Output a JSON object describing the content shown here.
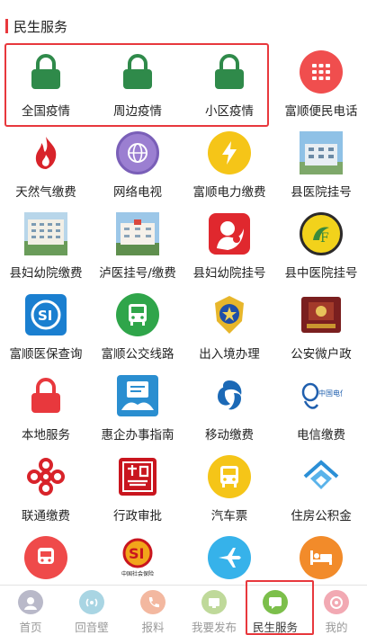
{
  "section": {
    "title": "民生服务"
  },
  "services": [
    {
      "label": "全国疫情",
      "icon": "green-lock-icon"
    },
    {
      "label": "周边疫情",
      "icon": "green-lock-icon"
    },
    {
      "label": "小区疫情",
      "icon": "green-lock-icon"
    },
    {
      "label": "富顺便民电话",
      "icon": "phone-keypad-icon"
    },
    {
      "label": "天然气缴费",
      "icon": "gas-flame-icon"
    },
    {
      "label": "网络电视",
      "icon": "network-tv-icon"
    },
    {
      "label": "富顺电力缴费",
      "icon": "lightning-icon"
    },
    {
      "label": "县医院挂号",
      "icon": "hospital-building-photo"
    },
    {
      "label": "县妇幼院缴费",
      "icon": "hospital-photo"
    },
    {
      "label": "泸医挂号/缴费",
      "icon": "hospital-photo"
    },
    {
      "label": "县妇幼院挂号",
      "icon": "maternal-child-logo"
    },
    {
      "label": "县中医院挂号",
      "icon": "tcm-hospital-logo"
    },
    {
      "label": "富顺医保查询",
      "icon": "social-insurance-icon"
    },
    {
      "label": "富顺公交线路",
      "icon": "bus-icon"
    },
    {
      "label": "出入境办理",
      "icon": "police-badge-icon"
    },
    {
      "label": "公安微户政",
      "icon": "household-register-icon"
    },
    {
      "label": "本地服务",
      "icon": "red-lock-icon"
    },
    {
      "label": "惠企办事指南",
      "icon": "enterprise-guide-icon"
    },
    {
      "label": "移动缴费",
      "icon": "china-mobile-icon"
    },
    {
      "label": "电信缴费",
      "icon": "china-telecom-icon"
    },
    {
      "label": "联通缴费",
      "icon": "china-unicom-icon"
    },
    {
      "label": "行政审批",
      "icon": "administrative-seal-icon"
    },
    {
      "label": "汽车票",
      "icon": "coach-bus-icon"
    },
    {
      "label": "住房公积金",
      "icon": "housing-fund-icon"
    },
    {
      "label": "",
      "icon": "metro-icon"
    },
    {
      "label": "",
      "icon": "social-security-logo"
    },
    {
      "label": "",
      "icon": "airplane-icon"
    },
    {
      "label": "",
      "icon": "hotel-bed-icon"
    }
  ],
  "social_logo_text": "中国社会保险",
  "telecom_logo_text": "中国电信",
  "tabs": [
    {
      "label": "首页",
      "icon": "home-avatar-icon"
    },
    {
      "label": "回音壁",
      "icon": "echo-wall-icon"
    },
    {
      "label": "报料",
      "icon": "report-phone-icon"
    },
    {
      "label": "我要发布",
      "icon": "publish-icon"
    },
    {
      "label": "民生服务",
      "icon": "service-chat-icon",
      "active": true
    },
    {
      "label": "我的",
      "icon": "profile-icon"
    }
  ],
  "colors": {
    "accent": "#e8383d",
    "green": "#2f8a4a",
    "tab_inactive": "#999999"
  }
}
